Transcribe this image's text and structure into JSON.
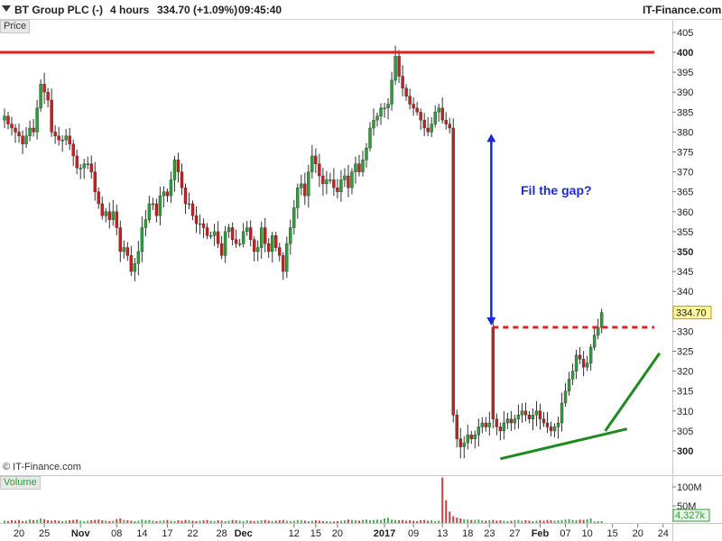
{
  "header": {
    "instrument": "BT Group PLC (-)",
    "interval": "4 hours",
    "quote": "334.70 (+1.09%)",
    "time": "09:45:40",
    "brand": "IT-Finance.com"
  },
  "price_panel_label": "Price",
  "volume_panel_label": "Volume",
  "watermark": "© IT-Finance.com",
  "annotation_text": "Fil the gap?",
  "last_price_label": "334.70",
  "last_volume_label": "4,327k",
  "colors": {
    "up": "#2e9e3a",
    "down": "#c42020",
    "resistance": "#e02020",
    "arrow": "#1a2ad8",
    "trend": "#1f8a1f",
    "gap_line": "#e02020"
  },
  "chart_data": {
    "type": "candlestick",
    "y_ticks": [
      300,
      305,
      310,
      315,
      320,
      325,
      330,
      335,
      340,
      345,
      350,
      355,
      360,
      365,
      370,
      375,
      380,
      385,
      390,
      395,
      400,
      405
    ],
    "y_bold_ticks": [
      300,
      350,
      400
    ],
    "ylim": [
      297,
      407
    ],
    "volume_ticks": [
      "100M",
      "50M"
    ],
    "x_ticks": [
      {
        "label": "20",
        "bar": 4
      },
      {
        "label": "25",
        "bar": 11
      },
      {
        "label": "Nov",
        "bar": 21,
        "bold": true
      },
      {
        "label": "08",
        "bar": 31
      },
      {
        "label": "14",
        "bar": 38
      },
      {
        "label": "17",
        "bar": 45
      },
      {
        "label": "22",
        "bar": 52
      },
      {
        "label": "28",
        "bar": 60
      },
      {
        "label": "Dec",
        "bar": 66,
        "bold": true
      },
      {
        "label": "12",
        "bar": 80
      },
      {
        "label": "15",
        "bar": 86
      },
      {
        "label": "20",
        "bar": 92
      },
      {
        "label": "2017",
        "bar": 105,
        "bold": true
      },
      {
        "label": "09",
        "bar": 113
      },
      {
        "label": "13",
        "bar": 121
      },
      {
        "label": "18",
        "bar": 128
      },
      {
        "label": "23",
        "bar": 134
      },
      {
        "label": "27",
        "bar": 141
      },
      {
        "label": "Feb",
        "bar": 148,
        "bold": true
      },
      {
        "label": "07",
        "bar": 155
      },
      {
        "label": "10",
        "bar": 161
      },
      {
        "label": "15",
        "bar": 168
      },
      {
        "label": "20",
        "bar": 175
      },
      {
        "label": "24",
        "bar": 182
      }
    ],
    "resistance_level": 400,
    "gap_level": 331,
    "gap_start_bar": 135,
    "arrow": {
      "bar": 134,
      "from": 380,
      "to": 331
    },
    "support_trend": {
      "from_bar": 137,
      "from_price": 298,
      "to_bar": 172,
      "to_price": 305.5
    },
    "rising_trend": {
      "from_bar": 166,
      "from_price": 305,
      "to_bar": 181,
      "to_price": 324.5
    },
    "closes": [
      384,
      382,
      381,
      380,
      379,
      377,
      379,
      381,
      380,
      386,
      392,
      390,
      388,
      380,
      379,
      378,
      378,
      379,
      377,
      374,
      371,
      371,
      372,
      372,
      370,
      365,
      362,
      359,
      360,
      358,
      360,
      356,
      350,
      351,
      349,
      345,
      347,
      350,
      356,
      358,
      362,
      362,
      359,
      364,
      365,
      364,
      368,
      373,
      370,
      366,
      362,
      362,
      359,
      357,
      357,
      356,
      354,
      354,
      355,
      352,
      349,
      355,
      356,
      353,
      352,
      352,
      355,
      356,
      353,
      350,
      351,
      356,
      352,
      350,
      354,
      351,
      349,
      345,
      352,
      356,
      361,
      366,
      367,
      364,
      370,
      374,
      372,
      369,
      367,
      368,
      368,
      366,
      365,
      368,
      369,
      366,
      370,
      372,
      370,
      373,
      376,
      381,
      383,
      384,
      386,
      386,
      387,
      393,
      399,
      394,
      391,
      389,
      387,
      386,
      385,
      383,
      381,
      380,
      382,
      385,
      386,
      383,
      382,
      381,
      309,
      303,
      301,
      302,
      304,
      303,
      304,
      306,
      307,
      306,
      307,
      308,
      306,
      305,
      307,
      308,
      307,
      308,
      309,
      310,
      309,
      308,
      309,
      310,
      308,
      307,
      306,
      305,
      306,
      307,
      312,
      315,
      318,
      320,
      324,
      323,
      321,
      322,
      326,
      329,
      331,
      334.7
    ],
    "volumes": [
      6,
      5,
      7,
      6,
      8,
      5,
      6,
      9,
      7,
      8,
      12,
      10,
      7,
      6,
      7,
      6,
      5,
      6,
      7,
      8,
      9,
      6,
      5,
      6,
      7,
      8,
      9,
      7,
      6,
      5,
      6,
      10,
      12,
      8,
      7,
      6,
      5,
      6,
      9,
      7,
      8,
      6,
      5,
      6,
      7,
      8,
      6,
      5,
      7,
      6,
      8,
      7,
      6,
      5,
      6,
      7,
      8,
      6,
      5,
      7,
      6,
      5,
      6,
      8,
      7,
      6,
      5,
      7,
      6,
      5,
      6,
      7,
      8,
      6,
      5,
      6,
      7,
      8,
      6,
      5,
      6,
      8,
      7,
      6,
      5,
      6,
      7,
      6,
      5,
      5,
      4,
      4,
      5,
      6,
      7,
      9,
      8,
      7,
      6,
      8,
      9,
      7,
      8,
      9,
      8,
      12,
      14,
      9,
      8,
      7,
      8,
      6,
      7,
      6,
      5,
      7,
      8,
      6,
      7,
      5,
      6,
      120,
      60,
      30,
      18,
      14,
      12,
      10,
      9,
      8,
      8,
      9,
      7,
      6,
      7,
      8,
      6,
      7,
      6,
      5,
      6,
      7,
      8,
      6,
      7,
      6,
      5,
      6,
      7,
      6,
      8,
      7,
      6,
      7,
      8,
      9,
      10,
      8,
      7,
      9,
      8,
      10,
      12,
      4
    ]
  }
}
